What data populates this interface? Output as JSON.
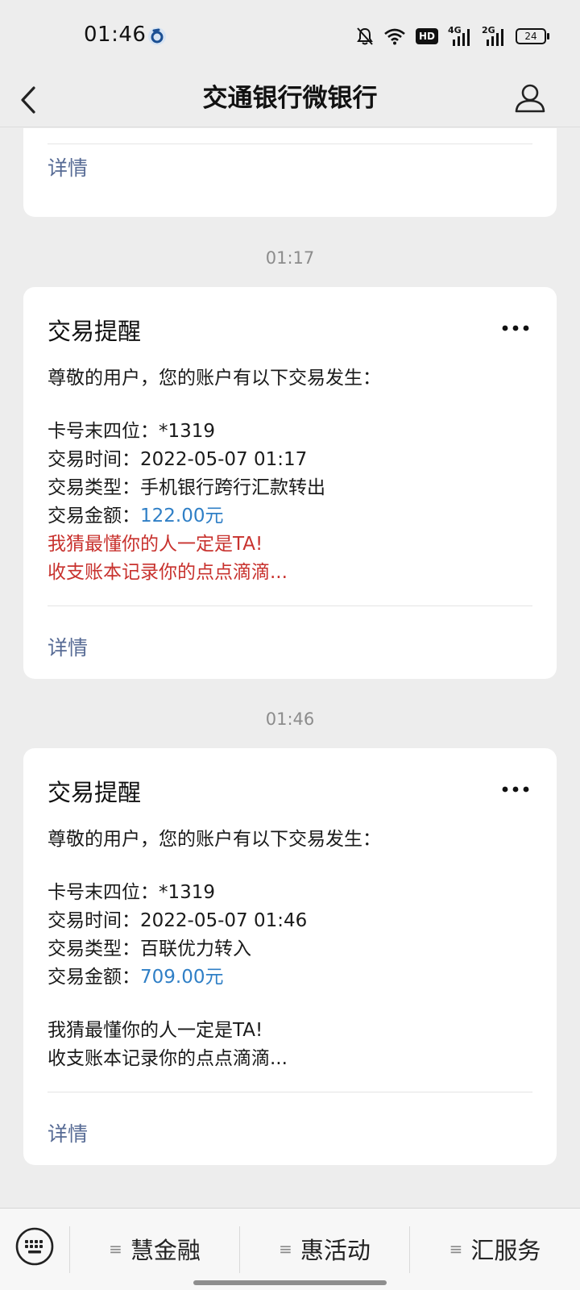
{
  "status_bar": {
    "time": "01:46",
    "network_badge": "HD",
    "signal_1": "4G",
    "signal_2": "2G",
    "battery": "24"
  },
  "nav": {
    "title": "交通银行微银行"
  },
  "cards": [
    {
      "detail_label": "详情"
    },
    {
      "timestamp": "01:17",
      "title": "交易提醒",
      "greeting": "尊敬的用户，您的账户有以下交易发生：",
      "card_no_label": "卡号末四位：",
      "card_no": "*1319",
      "time_label": "交易时间：",
      "time": "2022-05-07 01:17",
      "type_label": "交易类型：",
      "type": "手机银行跨行汇款转出",
      "amount_label": "交易金额：",
      "amount": "122.00元",
      "promo_1": "我猜最懂你的人一定是TA!",
      "promo_2": "收支账本记录你的点点滴滴...",
      "detail_label": "详情"
    },
    {
      "timestamp": "01:46",
      "title": "交易提醒",
      "greeting": "尊敬的用户，您的账户有以下交易发生：",
      "card_no_label": "卡号末四位：",
      "card_no": "*1319",
      "time_label": "交易时间：",
      "time": "2022-05-07 01:46",
      "type_label": "交易类型：",
      "type": "百联优力转入",
      "amount_label": "交易金额：",
      "amount": "709.00元",
      "promo_1": "我猜最懂你的人一定是TA!",
      "promo_2": "收支账本记录你的点点滴滴...",
      "detail_label": "详情"
    }
  ],
  "bottom_menu": {
    "items": [
      {
        "label": "慧金融"
      },
      {
        "label": "惠活动"
      },
      {
        "label": "汇服务"
      }
    ]
  },
  "colors": {
    "link": "#576b95",
    "amount": "#2f7fc6",
    "promo_red": "#c8322e",
    "background": "#ededed"
  }
}
